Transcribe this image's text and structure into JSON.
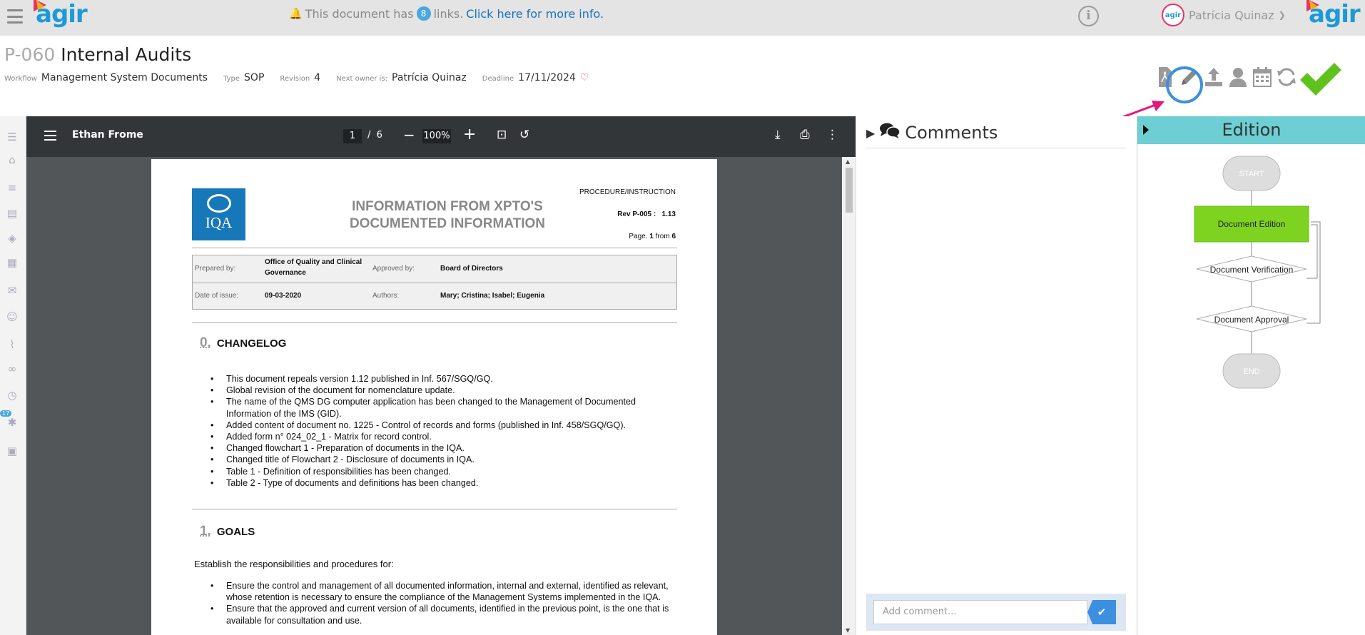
{
  "topbar": {
    "notice_pre": "This document has",
    "links_count": "8",
    "notice_post": "links.",
    "notice_link": "Click here for more info.",
    "user_name": "Patrícia Quinaz",
    "logo_text": "agir",
    "avatar_text": "agir"
  },
  "document": {
    "code": "P-060",
    "title": "Internal Audits",
    "workflow_label": "Workflow",
    "workflow": "Management System Documents",
    "type_label": "Type",
    "type": "SOP",
    "revision_label": "Revision",
    "revision": "4",
    "owner_label": "Next owner is:",
    "owner": "Patrícia Quinaz",
    "deadline_label": "Deadline",
    "deadline": "17/11/2024"
  },
  "actions": [
    "file-pdf-icon",
    "pencil-icon",
    "upload-icon",
    "user-icon",
    "calendar-icon",
    "refresh-icon",
    "check-icon"
  ],
  "viewer": {
    "title": "Ethan Frome",
    "page": "1",
    "page_sep": "/",
    "pages": "6",
    "zoom": "100%"
  },
  "pdf": {
    "logo_text": "IQA",
    "head_line1": "INFORMATION FROM XPTO'S",
    "head_line2": "DOCUMENTED INFORMATION",
    "type": "PROCEDURE/INSTRUCTION",
    "rev_label": "Rev P-005 :",
    "rev": "1.13",
    "page_text_pre": "Page.",
    "page_num": "1",
    "page_text_mid": "from",
    "page_total": "6",
    "prepared_label": "Prepared by:",
    "prepared_line1": "Office of Quality and Clinical",
    "prepared_line2": "Governance",
    "approved_label": "Approved by:",
    "approved": "Board of Directors",
    "date_label": "Date of issue:",
    "date": "09-03-2020",
    "authors_label": "Authors:",
    "authors": "Mary; Cristina; Isabel; Eugenia",
    "sec0_num": "0.",
    "sec0_title": "CHANGELOG",
    "changelog": [
      "This document repeals version 1.12 published in Inf. 567/SGQ/GQ.",
      "Global revision of the document for nomenclature update.",
      "The name of the QMS DG computer application has been changed to the Management of Documented Information of the IMS (GID).",
      "Added content of document no. 1225 - Control of records and forms (published in Inf. 458/SGQ/GQ).",
      "Added form n° 024_02_1 - Matrix for record control.",
      "Changed flowchart 1 - Preparation of documents in the IQA.",
      "Changed title of Flowchart 2 - Disclosure of documents in IQA.",
      "Table 1 - Definition of responsibilities has been changed.",
      "Table 2 - Type of documents and definitions has been changed."
    ],
    "sec1_num": "1.",
    "sec1_title": "GOALS",
    "goals_intro": "Establish the responsibilities and procedures for:",
    "goals": [
      "Ensure the control and management of all documented information, internal and external, identified as relevant, whose retention is necessary to ensure the compliance of the Management Systems implemented in the IQA.",
      "Ensure that the approved and current version of all documents, identified in the previous point, is the one that is available for consultation and use."
    ]
  },
  "comments": {
    "title": "Comments",
    "placeholder": "Add comment..."
  },
  "edition": {
    "title": "Edition",
    "flow": {
      "start": "START",
      "step1": "Document Edition",
      "step2": "Document Verification",
      "step3": "Document Approval",
      "end": "END"
    }
  },
  "nav_badge": "17",
  "colors": {
    "brand": "#1c9ad6",
    "accent_pink": "#e6336b",
    "active_step": "#7ed321",
    "edition_header": "#6dcfd3",
    "approve": "#5fc21c"
  }
}
